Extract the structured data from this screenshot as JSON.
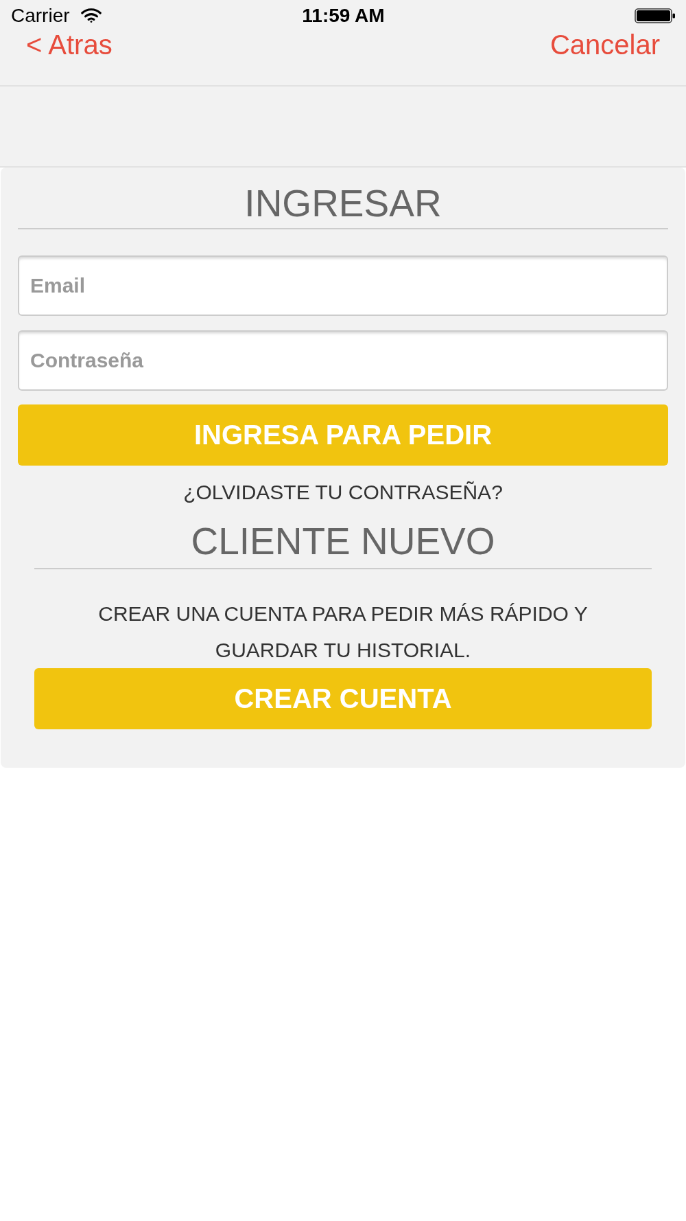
{
  "status_bar": {
    "carrier": "Carrier",
    "time": "11:59 AM"
  },
  "nav_bar": {
    "back": "< Atras",
    "cancel": "Cancelar"
  },
  "login": {
    "title": "INGRESAR",
    "fields": [
      {
        "placeholder": "Email"
      },
      {
        "placeholder": "Contraseña"
      }
    ],
    "submit": "INGRESA PARA PEDIR",
    "forgot": "¿OLVIDASTE TU CONTRASEÑA?"
  },
  "new_customer": {
    "title": "CLIENTE NUEVO",
    "description": "CREAR UNA CUENTA PARA PEDIR MÁS RÁPIDO Y GUARDAR TU HISTORIAL.",
    "button": "CREAR CUENTA"
  }
}
